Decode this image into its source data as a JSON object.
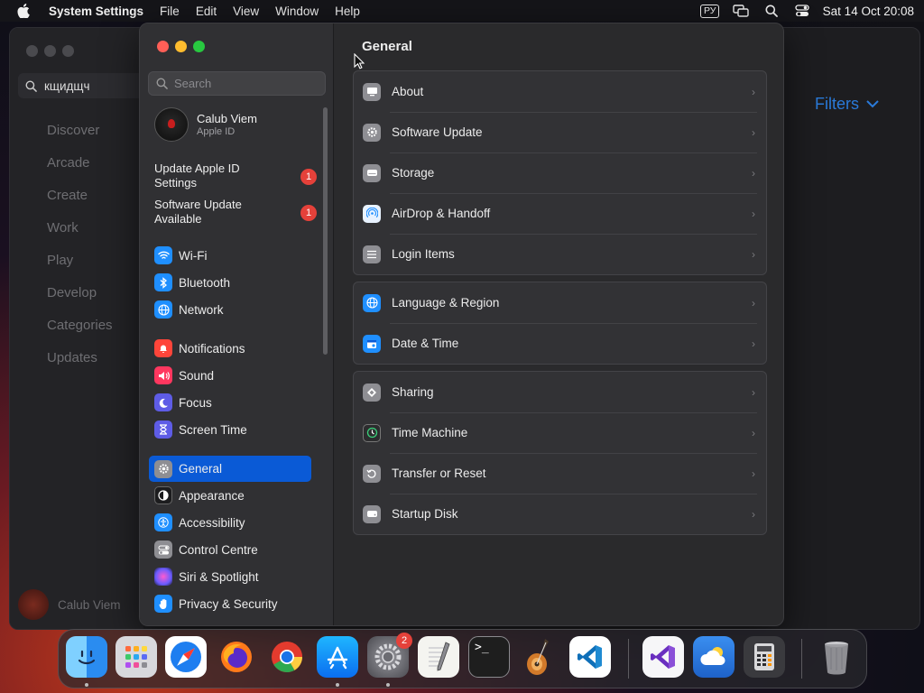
{
  "menubar": {
    "app_name": "System Settings",
    "menus": [
      "File",
      "Edit",
      "View",
      "Window",
      "Help"
    ],
    "keyboard_layout": "РУ",
    "clock": "Sat 14 Oct  20:08"
  },
  "background_app": {
    "search_value": "кщидщч",
    "nav": [
      "Discover",
      "Arcade",
      "Create",
      "Work",
      "Play",
      "Develop",
      "Categories",
      "Updates"
    ],
    "user_name": "Calub Viem",
    "filters_label": "Filters"
  },
  "settings": {
    "search_placeholder": "Search",
    "account": {
      "name": "Calub Viem",
      "subtitle": "Apple ID"
    },
    "notices": [
      {
        "label": "Update Apple ID Settings",
        "count": "1"
      },
      {
        "label": "Software Update Available",
        "count": "1"
      }
    ],
    "sidebar": [
      {
        "label": "Wi-Fi",
        "icon": "wifi-icon",
        "color": "#1f8fff"
      },
      {
        "label": "Bluetooth",
        "icon": "bluetooth-icon",
        "color": "#1f8fff"
      },
      {
        "label": "Network",
        "icon": "globe-icon",
        "color": "#1f8fff"
      },
      {
        "label": "Notifications",
        "icon": "bell-icon",
        "color": "#ff453a"
      },
      {
        "label": "Sound",
        "icon": "speaker-icon",
        "color": "#ff375f"
      },
      {
        "label": "Focus",
        "icon": "moon-icon",
        "color": "#5e5ce6"
      },
      {
        "label": "Screen Time",
        "icon": "hourglass-icon",
        "color": "#5e5ce6"
      },
      {
        "label": "General",
        "icon": "gear-icon",
        "color": "#8e8e93",
        "selected": true
      },
      {
        "label": "Appearance",
        "icon": "appearance-icon",
        "color": "#1c1c1e"
      },
      {
        "label": "Accessibility",
        "icon": "accessibility-icon",
        "color": "#1f8fff"
      },
      {
        "label": "Control Centre",
        "icon": "toggles-icon",
        "color": "#8e8e93"
      },
      {
        "label": "Siri & Spotlight",
        "icon": "siri-icon",
        "color": "#bf5af2"
      },
      {
        "label": "Privacy & Security",
        "icon": "hand-icon",
        "color": "#1f8fff"
      }
    ],
    "pane_title": "General",
    "groups": [
      [
        {
          "label": "About",
          "icon": "display-icon",
          "color": "#8e8e93"
        },
        {
          "label": "Software Update",
          "icon": "gear-badge-icon",
          "color": "#8e8e93"
        },
        {
          "label": "Storage",
          "icon": "drive-icon",
          "color": "#8e8e93"
        },
        {
          "label": "AirDrop & Handoff",
          "icon": "airdrop-icon",
          "color": "#e8f2ff"
        },
        {
          "label": "Login Items",
          "icon": "list-icon",
          "color": "#8e8e93"
        }
      ],
      [
        {
          "label": "Language & Region",
          "icon": "globe-icon",
          "color": "#1f8fff"
        },
        {
          "label": "Date & Time",
          "icon": "calendar-icon",
          "color": "#1f8fff"
        }
      ],
      [
        {
          "label": "Sharing",
          "icon": "sharing-icon",
          "color": "#8e8e93"
        },
        {
          "label": "Time Machine",
          "icon": "time-machine-icon",
          "color": "#2c2c2e"
        },
        {
          "label": "Transfer or Reset",
          "icon": "reset-icon",
          "color": "#8e8e93"
        },
        {
          "label": "Startup Disk",
          "icon": "disk-icon",
          "color": "#8e8e93"
        }
      ]
    ]
  },
  "dock": {
    "apps": [
      {
        "name": "Finder",
        "icon": "finder-icon",
        "running": true
      },
      {
        "name": "Launchpad",
        "icon": "launchpad-icon",
        "running": false
      },
      {
        "name": "Safari",
        "icon": "safari-icon",
        "running": false
      },
      {
        "name": "Firefox",
        "icon": "firefox-icon",
        "running": false
      },
      {
        "name": "Chrome",
        "icon": "chrome-icon",
        "running": false
      },
      {
        "name": "App Store",
        "icon": "app-store-icon",
        "running": true
      },
      {
        "name": "System Settings",
        "icon": "settings-icon",
        "running": true,
        "badge": "2"
      },
      {
        "name": "TextEdit",
        "icon": "textedit-icon",
        "running": false
      },
      {
        "name": "Terminal",
        "icon": "terminal-icon",
        "running": false
      },
      {
        "name": "GarageBand",
        "icon": "garageband-icon",
        "running": false
      },
      {
        "name": "VS Code",
        "icon": "vscode-icon",
        "running": false
      },
      {
        "name": "Visual Studio",
        "icon": "visual-studio-icon",
        "running": false
      },
      {
        "name": "Weather",
        "icon": "weather-icon",
        "running": false
      },
      {
        "name": "Calculator",
        "icon": "calculator-icon",
        "running": false
      },
      {
        "name": "Trash",
        "icon": "trash-icon",
        "running": false
      }
    ]
  }
}
